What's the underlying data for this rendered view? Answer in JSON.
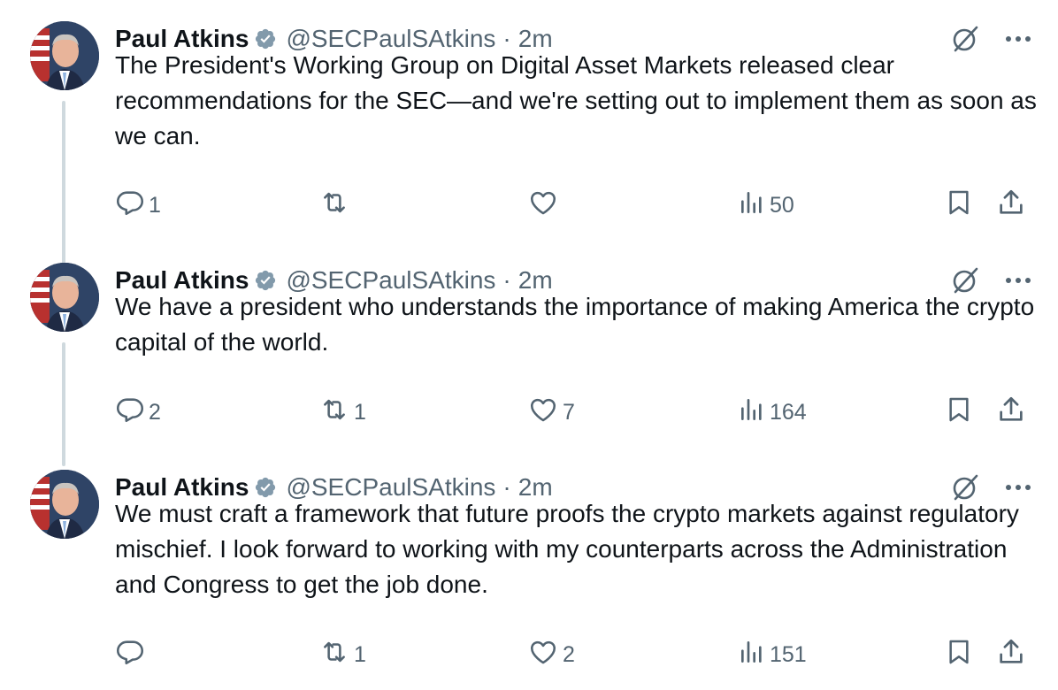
{
  "tweets": [
    {
      "author_name": "Paul Atkins",
      "handle": "@SECPaulSAtkins",
      "separator": "·",
      "time": "2m",
      "text": "The President's Working Group on Digital Asset Markets released clear recommendations for the SEC—and we're setting out to implement them as soon as we can.",
      "replies": "1",
      "reposts": "",
      "likes": "",
      "views": "50"
    },
    {
      "author_name": "Paul Atkins",
      "handle": "@SECPaulSAtkins",
      "separator": "·",
      "time": "2m",
      "text": "We have a president who understands the importance of making America the crypto capital of the world.",
      "replies": "2",
      "reposts": "1",
      "likes": "7",
      "views": "164"
    },
    {
      "author_name": "Paul Atkins",
      "handle": "@SECPaulSAtkins",
      "separator": "·",
      "time": "2m",
      "text": "We must craft a framework that future proofs the crypto markets against regulatory mischief. I look forward to working with my counterparts across the Administration and Congress to get the job done.",
      "replies": "",
      "reposts": "1",
      "likes": "2",
      "views": "151"
    }
  ],
  "icons": {
    "verified": "verified-badge-icon",
    "grok": "grok-icon",
    "more": "more-icon",
    "reply": "reply-icon",
    "repost": "repost-icon",
    "like": "like-icon",
    "views": "views-icon",
    "bookmark": "bookmark-icon",
    "share": "share-icon"
  },
  "colors": {
    "text": "#0f1419",
    "muted": "#536471",
    "thread_line": "#cfd9de",
    "verified_badge": "#829aab"
  }
}
